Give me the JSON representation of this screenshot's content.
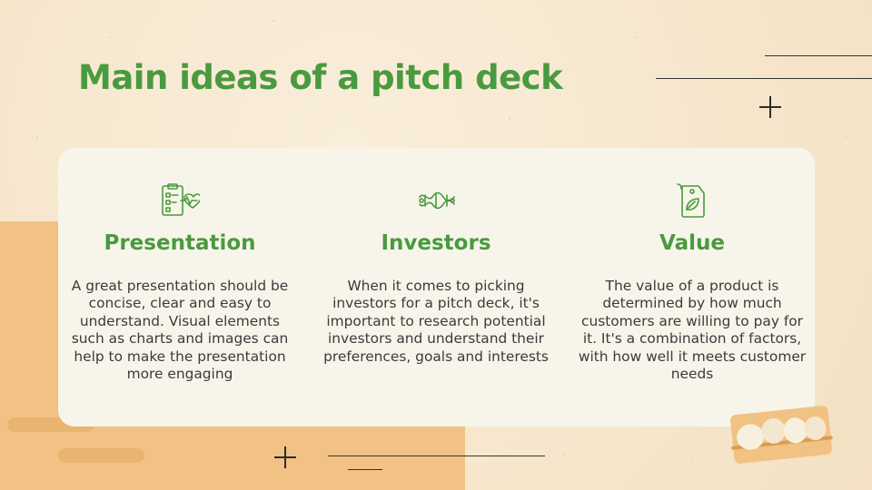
{
  "slide": {
    "title": "Main ideas of a pitch deck"
  },
  "columns": [
    {
      "icon": "clipboard-heartbeat-icon",
      "heading": "Presentation",
      "text": "A great presentation should be concise, clear and easy to understand. Visual elements such as charts and images can help to make the presentation more engaging"
    },
    {
      "icon": "virus-molecule-icon",
      "heading": "Investors",
      "text": "When it comes to picking investors for a pitch deck, it's important to research potential investors and understand their preferences, goals and interests"
    },
    {
      "icon": "eco-tag-icon",
      "heading": "Value",
      "text": "The value of a product is determined by how much customers are willing to pay for it. It's a combination of factors, with how well it meets customer needs"
    }
  ],
  "colors": {
    "accent_green": "#4a9a3f",
    "background_cream": "#f6e7cf",
    "card_bg": "#f7f5ea",
    "orange_block": "#f1c283"
  }
}
